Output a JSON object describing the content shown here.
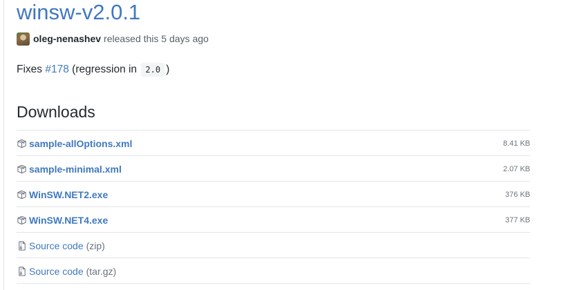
{
  "release": {
    "title": "winsw-v2.0.1",
    "author": "oleg-nenashev",
    "released_text": "released this 5 days ago"
  },
  "notes": {
    "prefix": "Fixes",
    "issue_link": "#178",
    "middle": "(regression in",
    "code": "2.0",
    "suffix": ")"
  },
  "downloads": {
    "heading": "Downloads",
    "assets": [
      {
        "name": "sample-allOptions.xml",
        "size": "8.41 KB",
        "icon": "package-icon"
      },
      {
        "name": "sample-minimal.xml",
        "size": "2.07 KB",
        "icon": "package-icon"
      },
      {
        "name": "WinSW.NET2.exe",
        "size": "376 KB",
        "icon": "package-icon"
      },
      {
        "name": "WinSW.NET4.exe",
        "size": "377 KB",
        "icon": "package-icon"
      }
    ],
    "source": [
      {
        "name": "Source code",
        "suffix": "(zip)",
        "icon": "file-zip-icon"
      },
      {
        "name": "Source code",
        "suffix": "(tar.gz)",
        "icon": "file-zip-icon"
      }
    ]
  },
  "colors": {
    "link": "#4078c0",
    "text": "#24292e",
    "muted": "#586069",
    "border": "#e1e4e8"
  }
}
